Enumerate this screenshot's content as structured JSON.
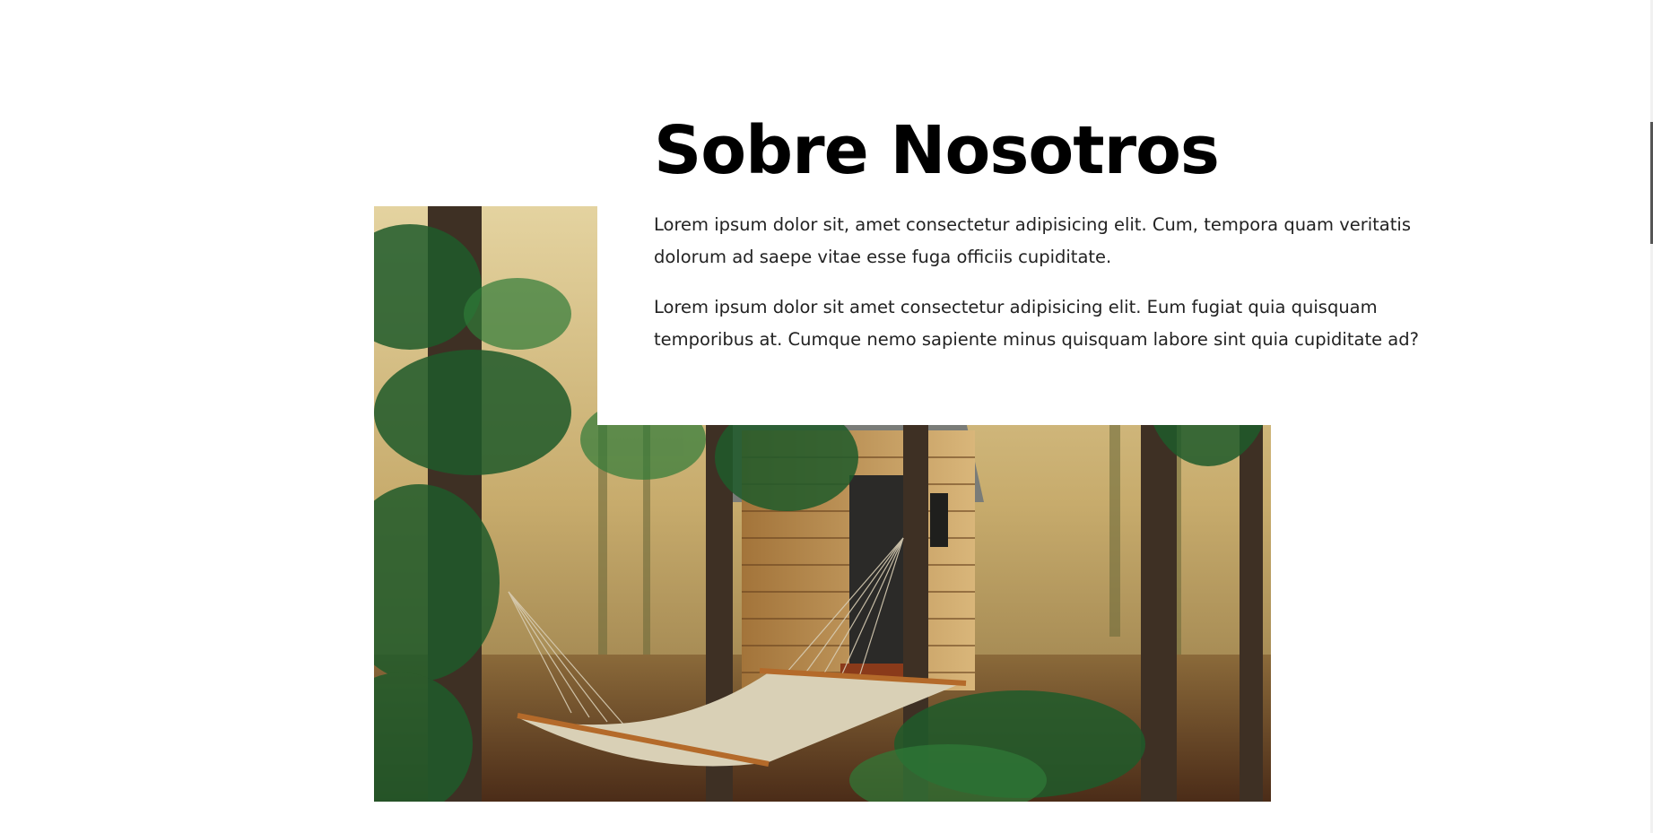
{
  "about": {
    "title": "Sobre Nosotros",
    "paragraph_1": "Lorem ipsum dolor sit, amet consectetur adipisicing elit. Cum, tempora quam veritatis dolorum ad saepe vitae esse fuga officiis cupiditate.",
    "paragraph_2": "Lorem ipsum dolor sit amet consectetur adipisicing elit. Eum fugiat quia quisquam temporibus at. Cumque nemo sapiente minus quisquam labore sint quia cupiditate ad?"
  },
  "image": {
    "subject": "forest-cabin-hammock-photo"
  },
  "colors": {
    "heading": "#000000",
    "body_text": "#222222",
    "background": "#ffffff"
  }
}
